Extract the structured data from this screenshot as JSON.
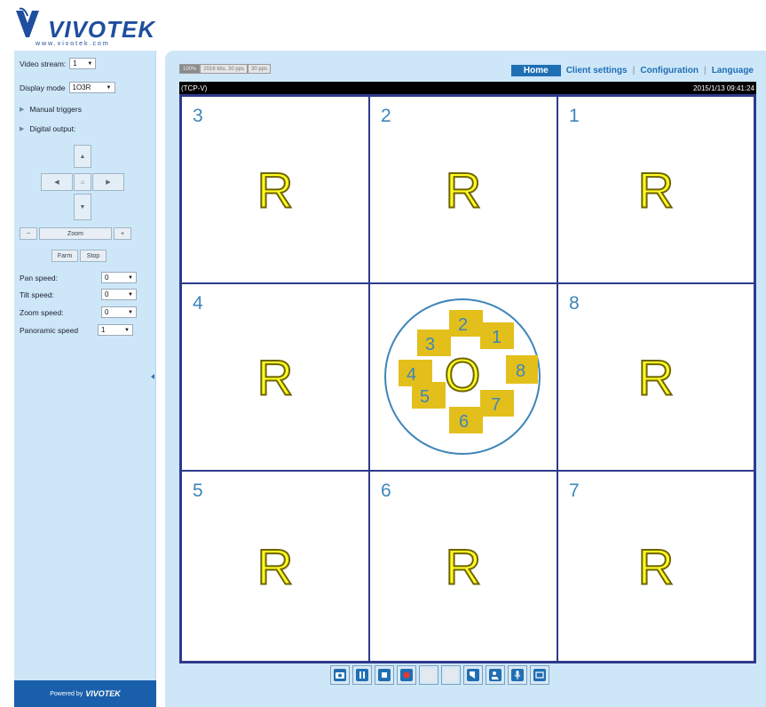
{
  "brand": {
    "name": "VIVOTEK",
    "url": "www.vivotek.com"
  },
  "left_panel": {
    "video_stream_label": "Video stream:",
    "video_stream_value": "1",
    "display_mode_label": "Display mode",
    "display_mode_value": "1O3R",
    "manual_triggers": "Manual triggers",
    "digital_output": "Digital output:",
    "zoom_label": "Zoom",
    "zoom_minus": "−",
    "zoom_plus": "+",
    "far_label": "Farm",
    "stop_label": "Stop",
    "pan_speed_label": "Pan speed:",
    "pan_speed_value": "0",
    "tilt_speed_label": "Tilt speed:",
    "tilt_speed_value": "0",
    "zoom_speed_label": "Zoom speed:",
    "zoom_speed_value": "0",
    "panoramic_speed_label": "Panoramic speed",
    "panoramic_speed_value": "1",
    "powered_by": "Powered by",
    "powered_brand": "VIVOTEK"
  },
  "status_tabs": [
    "100%",
    "2016 kbs, 30 pps",
    "30 pps"
  ],
  "nav": {
    "home": "Home",
    "client_settings": "Client settings",
    "configuration": "Configuration",
    "language": "Language"
  },
  "video_header": {
    "protocol": "(TCP-V)",
    "timestamp": "2015/1/13 09:41:24"
  },
  "grid": {
    "r_letter": "R",
    "cells": [
      {
        "number": "3"
      },
      {
        "number": "2"
      },
      {
        "number": "1"
      },
      {
        "number": "4"
      },
      {
        "number": ""
      },
      {
        "number": "8"
      },
      {
        "number": "5"
      },
      {
        "number": "6"
      },
      {
        "number": "7"
      }
    ],
    "center": {
      "letter": "O",
      "segments": [
        "1",
        "2",
        "3",
        "4",
        "5",
        "6",
        "7",
        "8"
      ],
      "segment_color": "#e3bf1c",
      "circle_color": "#3e86b8"
    }
  },
  "toolbar_icons": [
    "camera-icon",
    "pause-icon",
    "stop-icon",
    "record-icon",
    "blank-icon",
    "blank-icon",
    "volume-icon",
    "talk-icon",
    "microphone-icon",
    "fullscreen-icon"
  ],
  "colors": {
    "panel": "#cde7f8",
    "accent": "#1f6fb4",
    "grid_border": "#2e3a8c",
    "number": "#3e86b8",
    "r_fill": "#ffff24"
  }
}
